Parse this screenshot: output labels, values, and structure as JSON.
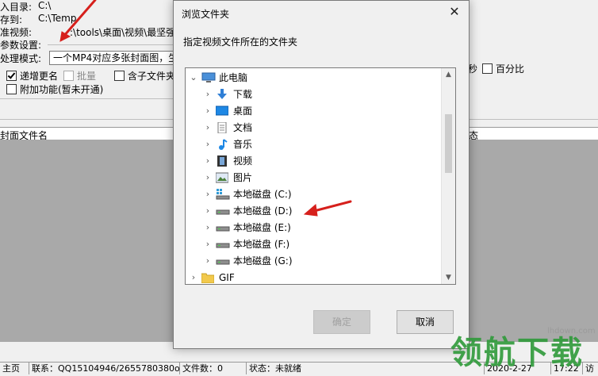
{
  "background_app": {
    "input_dir_label": "入目录:",
    "input_dir_value": "C:\\",
    "save_to_label": "存到:",
    "save_to_value": "C:\\Temp",
    "std_video_label": "准视频:",
    "std_video_value": ":\\tools\\桌面\\视频\\最坚强",
    "params_label": "参数设置:",
    "mode_label": "处理模式:",
    "mode_value": "一个MP4对应多张封面图，生",
    "chk_increment": "递增更名",
    "chk_batch": "批量",
    "chk_subfolder": "含子文件夹",
    "chk_extra": "附加功能(暂未开通)",
    "right_sec": "秒",
    "chk_percent": "百分比",
    "col_cover_name": "封面文件名",
    "col_status_fragment": "态",
    "status_home": "主页",
    "status_contact": "联系：QQ15104946/2655780380o",
    "status_filecount": "文件数：0",
    "status_state": "状态：未就绪",
    "status_date": "2020-2-27",
    "status_time": "17:22",
    "status_end": "访"
  },
  "dialog": {
    "title": "浏览文件夹",
    "close_glyph": "✕",
    "prompt": "指定视频文件所在的文件夹",
    "tree": [
      {
        "label": "此电脑",
        "icon": "computer-icon",
        "level": 0,
        "expanded": true
      },
      {
        "label": "下载",
        "icon": "download-icon",
        "level": 1
      },
      {
        "label": "桌面",
        "icon": "desktop-icon",
        "level": 1
      },
      {
        "label": "文档",
        "icon": "document-icon",
        "level": 1
      },
      {
        "label": "音乐",
        "icon": "music-icon",
        "level": 1
      },
      {
        "label": "视频",
        "icon": "video-icon",
        "level": 1
      },
      {
        "label": "图片",
        "icon": "picture-icon",
        "level": 1
      },
      {
        "label": "本地磁盘 (C:)",
        "icon": "system-drive-icon",
        "level": 1
      },
      {
        "label": "本地磁盘 (D:)",
        "icon": "drive-icon",
        "level": 1
      },
      {
        "label": "本地磁盘 (E:)",
        "icon": "drive-icon",
        "level": 1
      },
      {
        "label": "本地磁盘 (F:)",
        "icon": "drive-icon",
        "level": 1
      },
      {
        "label": "本地磁盘 (G:)",
        "icon": "drive-icon",
        "level": 1
      },
      {
        "label": "GIF",
        "icon": "folder-icon",
        "level": 0
      }
    ],
    "ok_label": "确定",
    "cancel_label": "取消"
  },
  "watermark": {
    "site": "lhdown.com",
    "brand": "领航下载"
  },
  "colors": {
    "annotation_arrow": "#d6201c",
    "watermark_green": "#2f9a3a",
    "list_background": "#a9a9a9"
  }
}
